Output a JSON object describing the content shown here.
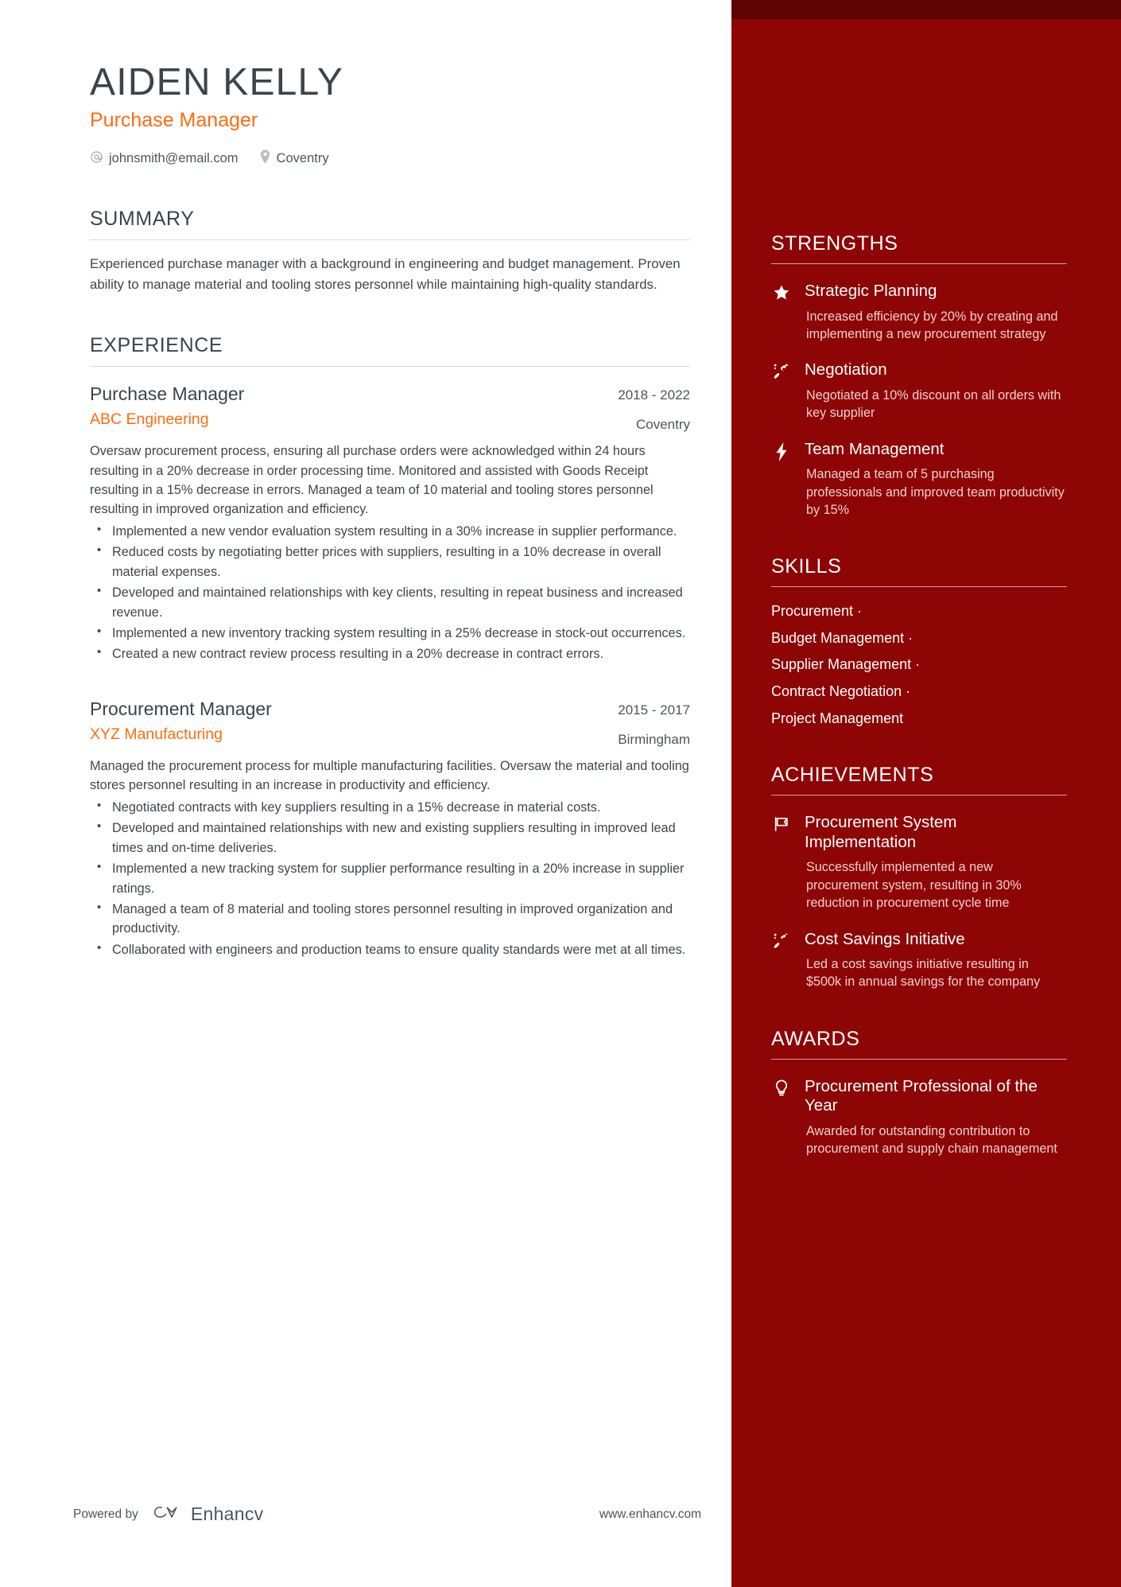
{
  "header": {
    "name": "AIDEN KELLY",
    "role": "Purchase Manager",
    "email": "johnsmith@email.com",
    "location": "Coventry"
  },
  "summary": {
    "title": "SUMMARY",
    "text": "Experienced purchase manager with a background in engineering and budget management. Proven ability to manage material and tooling stores personnel while maintaining high-quality standards."
  },
  "experience": {
    "title": "EXPERIENCE",
    "jobs": [
      {
        "title": "Purchase Manager",
        "company": "ABC Engineering",
        "dates": "2018 - 2022",
        "location": "Coventry",
        "description": "Oversaw procurement process, ensuring all purchase orders were acknowledged within 24 hours resulting in a 20% decrease in order processing time. Monitored and assisted with Goods Receipt resulting in a 15% decrease in errors. Managed a team of 10 material and tooling stores personnel resulting in improved organization and efficiency.",
        "bullets": [
          "Implemented a new vendor evaluation system resulting in a 30% increase in supplier performance.",
          "Reduced costs by negotiating better prices with suppliers, resulting in a 10% decrease in overall material expenses.",
          "Developed and maintained relationships with key clients, resulting in repeat business and increased revenue.",
          "Implemented a new inventory tracking system resulting in a 25% decrease in stock-out occurrences.",
          "Created a new contract review process resulting in a 20% decrease in contract errors."
        ]
      },
      {
        "title": "Procurement Manager",
        "company": "XYZ Manufacturing",
        "dates": "2015 - 2017",
        "location": "Birmingham",
        "description": "Managed the procurement process for multiple manufacturing facilities. Oversaw the material and tooling stores personnel resulting in an increase in productivity and efficiency.",
        "bullets": [
          "Negotiated contracts with key suppliers resulting in a 15% decrease in material costs.",
          "Developed and maintained relationships with new and existing suppliers resulting in improved lead times and on-time deliveries.",
          "Implemented a new tracking system for supplier performance resulting in a 20% increase in supplier ratings.",
          "Managed a team of 8 material and tooling stores personnel resulting in improved organization and productivity.",
          "Collaborated with engineers and production teams to ensure quality standards were met at all times."
        ]
      }
    ]
  },
  "strengths": {
    "title": "STRENGTHS",
    "items": [
      {
        "icon": "star-icon",
        "title": "Strategic Planning",
        "desc": "Increased efficiency by 20% by creating and implementing a new procurement strategy"
      },
      {
        "icon": "rocket-icon",
        "title": "Negotiation",
        "desc": "Negotiated a 10% discount on all orders with key supplier"
      },
      {
        "icon": "lightning-icon",
        "title": "Team Management",
        "desc": "Managed a team of 5 purchasing professionals and improved team productivity by 15%"
      }
    ]
  },
  "skills": {
    "title": "SKILLS",
    "items": [
      "Procurement ·",
      "Budget Management ·",
      "Supplier Management ·",
      "Contract Negotiation ·",
      "Project Management"
    ]
  },
  "achievements": {
    "title": "ACHIEVEMENTS",
    "items": [
      {
        "icon": "flag-icon",
        "title": "Procurement System Implementation",
        "desc": "Successfully implemented a new procurement system, resulting in 30% reduction in procurement cycle time"
      },
      {
        "icon": "rocket-icon",
        "title": "Cost Savings Initiative",
        "desc": "Led a cost savings initiative resulting in $500k in annual savings for the company"
      }
    ]
  },
  "awards": {
    "title": "AWARDS",
    "items": [
      {
        "icon": "lightbulb-icon",
        "title": "Procurement Professional of the Year",
        "desc": "Awarded for outstanding contribution to procurement and supply chain management"
      }
    ]
  },
  "footer": {
    "powered_by": "Powered by",
    "brand": "Enhancv",
    "site": "www.enhancv.com"
  },
  "colors": {
    "accent_orange": "#ff6b11",
    "sidebar_red": "#8d0505",
    "sidebar_band": "#5e0303",
    "heading_dark": "#39444c"
  }
}
